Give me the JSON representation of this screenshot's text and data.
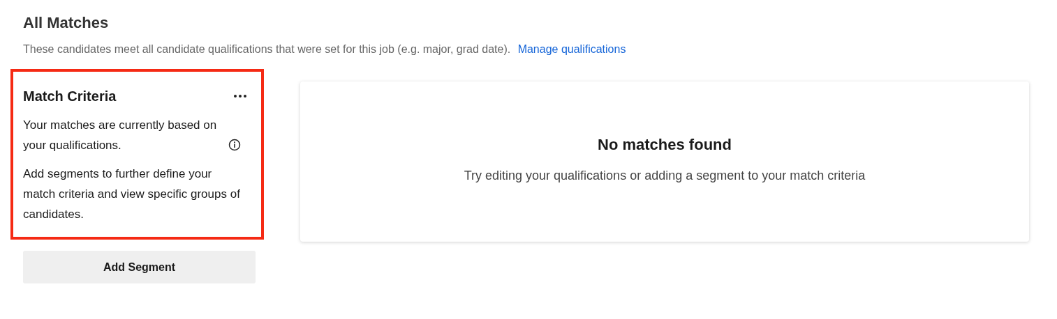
{
  "heading": "All Matches",
  "description": "These candidates meet all candidate qualifications that were set for this job (e.g. major, grad date).",
  "description_link": "Manage qualifications",
  "criteria": {
    "title": "Match Criteria",
    "highlighted": true,
    "paragraphs": [
      "Your matches are currently based on your qualifications.",
      "Add segments to further define your match criteria and view specific groups of candidates."
    ]
  },
  "add_button": "Add Segment",
  "empty_state": {
    "title": "No matches found",
    "message": "Try editing your qualifications or adding a segment to your match criteria"
  }
}
